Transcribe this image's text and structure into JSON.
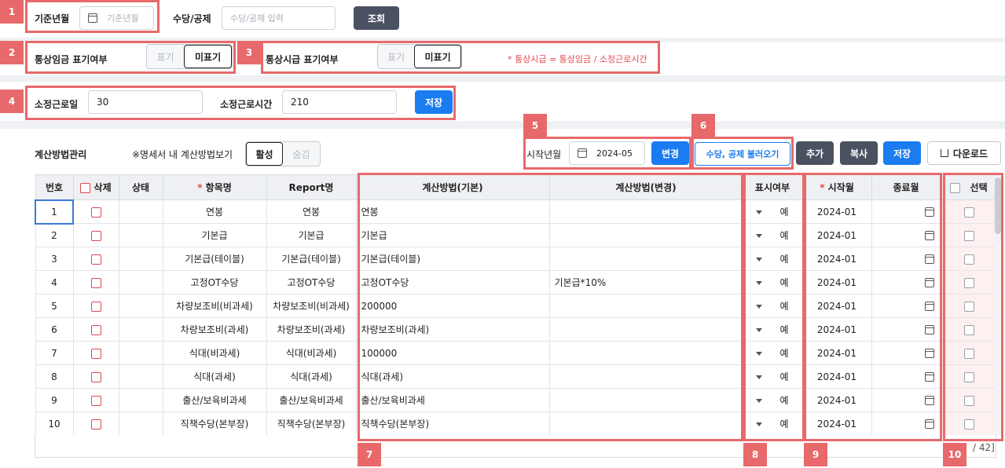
{
  "filter": {
    "base_month_label": "기준년월",
    "base_month_placeholder": "기준년월",
    "allowance_label": "수당/공제",
    "allowance_placeholder": "수당/공제 입력",
    "search_button": "조회"
  },
  "ordinary_wage": {
    "label": "통상임금 표기여부",
    "options": [
      "표기",
      "미표기"
    ],
    "selected": "미표기"
  },
  "ordinary_hourly": {
    "label": "통상시급 표기여부",
    "options": [
      "표기",
      "미표기"
    ],
    "selected": "미표기",
    "note": "* 통상시급 = 통상임금 / 소정근로시간"
  },
  "work": {
    "days_label": "소정근로일",
    "days_value": "30",
    "hours_label": "소정근로시간",
    "hours_value": "210",
    "save_button": "저장"
  },
  "toolbar": {
    "title": "계산방법관리",
    "view_label": "※명세서 내 계산방법보기",
    "view_options": [
      "활성",
      "숨김"
    ],
    "start_month_label": "시작년월",
    "start_month_value": "2024-05",
    "change_button": "변경",
    "import_button": "수당, 공제 불러오기",
    "add_button": "추가",
    "copy_button": "복사",
    "save_button": "저장",
    "download_button": "다운로드"
  },
  "table": {
    "headers": {
      "no": "번호",
      "delete": "삭제",
      "status": "상태",
      "item": "항목명",
      "report": "Report명",
      "method_base": "계산방법(기본)",
      "method_change": "계산방법(변경)",
      "display": "표시여부",
      "start": "시작월",
      "end": "종료월",
      "select": "선택"
    },
    "required_mark": "*",
    "rows": [
      {
        "no": "1",
        "item": "연봉",
        "report": "연봉",
        "base": "연봉",
        "change": "",
        "display": "예",
        "start": "2024-01"
      },
      {
        "no": "2",
        "item": "기본급",
        "report": "기본급",
        "base": "기본급",
        "change": "",
        "display": "예",
        "start": "2024-01"
      },
      {
        "no": "3",
        "item": "기본급(테이블)",
        "report": "기본급(테이블)",
        "base": "기본급(테이블)",
        "change": "",
        "display": "예",
        "start": "2024-01"
      },
      {
        "no": "4",
        "item": "고정OT수당",
        "report": "고정OT수당",
        "base": "고정OT수당",
        "change": "기본급*10%",
        "display": "예",
        "start": "2024-01"
      },
      {
        "no": "5",
        "item": "차량보조비(비과세)",
        "report": "차량보조비(비과세)",
        "base": "200000",
        "change": "",
        "display": "예",
        "start": "2024-01"
      },
      {
        "no": "6",
        "item": "차량보조비(과세)",
        "report": "차량보조비(과세)",
        "base": "차량보조비(과세)",
        "change": "",
        "display": "예",
        "start": "2024-01"
      },
      {
        "no": "7",
        "item": "식대(비과세)",
        "report": "식대(비과세)",
        "base": "100000",
        "change": "",
        "display": "예",
        "start": "2024-01"
      },
      {
        "no": "8",
        "item": "식대(과세)",
        "report": "식대(과세)",
        "base": "식대(과세)",
        "change": "",
        "display": "예",
        "start": "2024-01"
      },
      {
        "no": "9",
        "item": "출산/보육비과세",
        "report": "출산/보육비과세",
        "base": "출산/보육비과세",
        "change": "",
        "display": "예",
        "start": "2024-01"
      },
      {
        "no": "10",
        "item": "직책수당(본부장)",
        "report": "직책수당(본부장)",
        "base": "직책수당(본부장)",
        "change": "",
        "display": "예",
        "start": "2024-01"
      }
    ],
    "pager_text": "/ 42]"
  },
  "markers": [
    "1",
    "2",
    "3",
    "4",
    "5",
    "6",
    "7",
    "8",
    "9",
    "10"
  ],
  "colors": {
    "annotation": "#e8696b",
    "primary": "#1a7cf0",
    "dark_button": "#4a5160"
  }
}
